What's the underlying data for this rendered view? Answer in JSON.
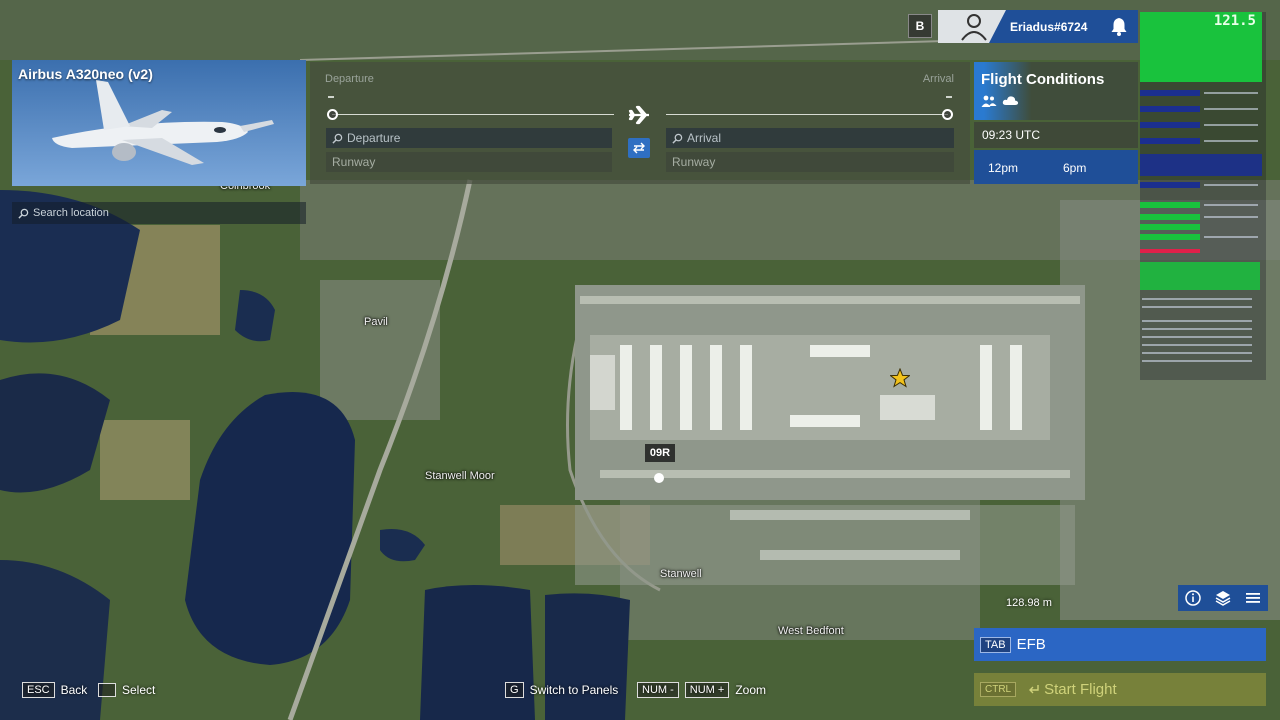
{
  "aircraft": {
    "title": "Airbus A320neo (v2)",
    "search_placeholder": "Search location"
  },
  "route": {
    "departure_caption": "Departure",
    "arrival_caption": "Arrival",
    "departure_placeholder": "Departure",
    "arrival_placeholder": "Arrival",
    "departure_runway": "Runway",
    "arrival_runway": "Runway"
  },
  "conditions": {
    "title": "Flight Conditions",
    "time": "09:23 UTC",
    "timeline": [
      "12pm",
      "6pm"
    ]
  },
  "user": {
    "badge": "B",
    "name": "Eriadus#6724"
  },
  "debug": {
    "fps": "121.5"
  },
  "map": {
    "runway": "09R",
    "places": [
      "Stanwell Moor",
      "Stanwell",
      "West Bedfont",
      "Pavil",
      "Colnbrook"
    ],
    "scale": "128.98 m"
  },
  "efb": {
    "key": "TAB",
    "label": "EFB"
  },
  "start_flight": {
    "key": "CTRL",
    "label": "Start Flight"
  },
  "hints": {
    "back_key": "ESC",
    "back": "Back",
    "select": "Select",
    "panels_key": "G",
    "panels": "Switch to Panels",
    "zoom_out_key": "NUM -",
    "zoom_in_key": "NUM +",
    "zoom": "Zoom"
  },
  "colors": {
    "accent": "#2b66c4",
    "panel_blue": "#1f4f98",
    "fps_green": "#19c23d"
  }
}
